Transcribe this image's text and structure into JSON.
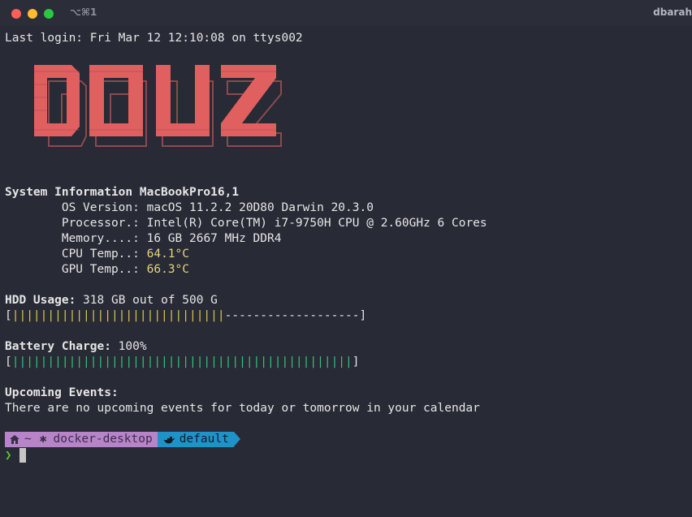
{
  "titlebar": {
    "shortcut": "⌥⌘1",
    "user": "dbarah"
  },
  "terminal": {
    "last_login": "Last login: Fri Mar 12 12:10:08 on ttys002",
    "logo_text": "DOUZ",
    "sysinfo": {
      "heading": "System Information MacBookPro16,1",
      "os_label": "        OS Version: ",
      "os_value": "macOS 11.2.2 20D80 Darwin 20.3.0",
      "cpu_label": "        Processor.: ",
      "cpu_value": "Intel(R) Core(TM) i7-9750H CPU @ 2.60GHz 6 Cores",
      "mem_label": "        Memory....: ",
      "mem_value": "16 GB 2667 MHz DDR4",
      "cput_label": "        CPU Temp..: ",
      "cput_value": "64.1°C",
      "gput_label": "        GPU Temp..: ",
      "gput_value": "66.3°C"
    },
    "hdd": {
      "heading": "HDD Usage:",
      "value": " 318 GB out of 500 G",
      "bar_open": "[",
      "bar_fill": "||||||||||||||||||||||||||||||",
      "bar_empty": "-------------------",
      "bar_close": "]",
      "fraction": 0.636
    },
    "battery": {
      "heading": "Battery Charge:",
      "value": " 100%",
      "bar_open": "[",
      "bar_fill": "||||||||||||||||||||||||||||||||||||||||||||||||",
      "bar_close": "]",
      "fraction": 1.0
    },
    "events": {
      "heading": "Upcoming Events:",
      "text": "There are no upcoming events for today or tomorrow in your calendar"
    },
    "prompt": {
      "home": "~",
      "docker": "docker-desktop",
      "context": "default",
      "chevron": "❯"
    }
  },
  "colors": {
    "background": "#282a35",
    "logo": "#e05f5f",
    "yellow_value": "#e3d67f",
    "hdd_bar": "#d9c54c",
    "battery_bar": "#31c27a",
    "prompt_purple": "#b784c9",
    "prompt_blue": "#1f93c8",
    "prompt_chevron": "#5fc23a"
  }
}
